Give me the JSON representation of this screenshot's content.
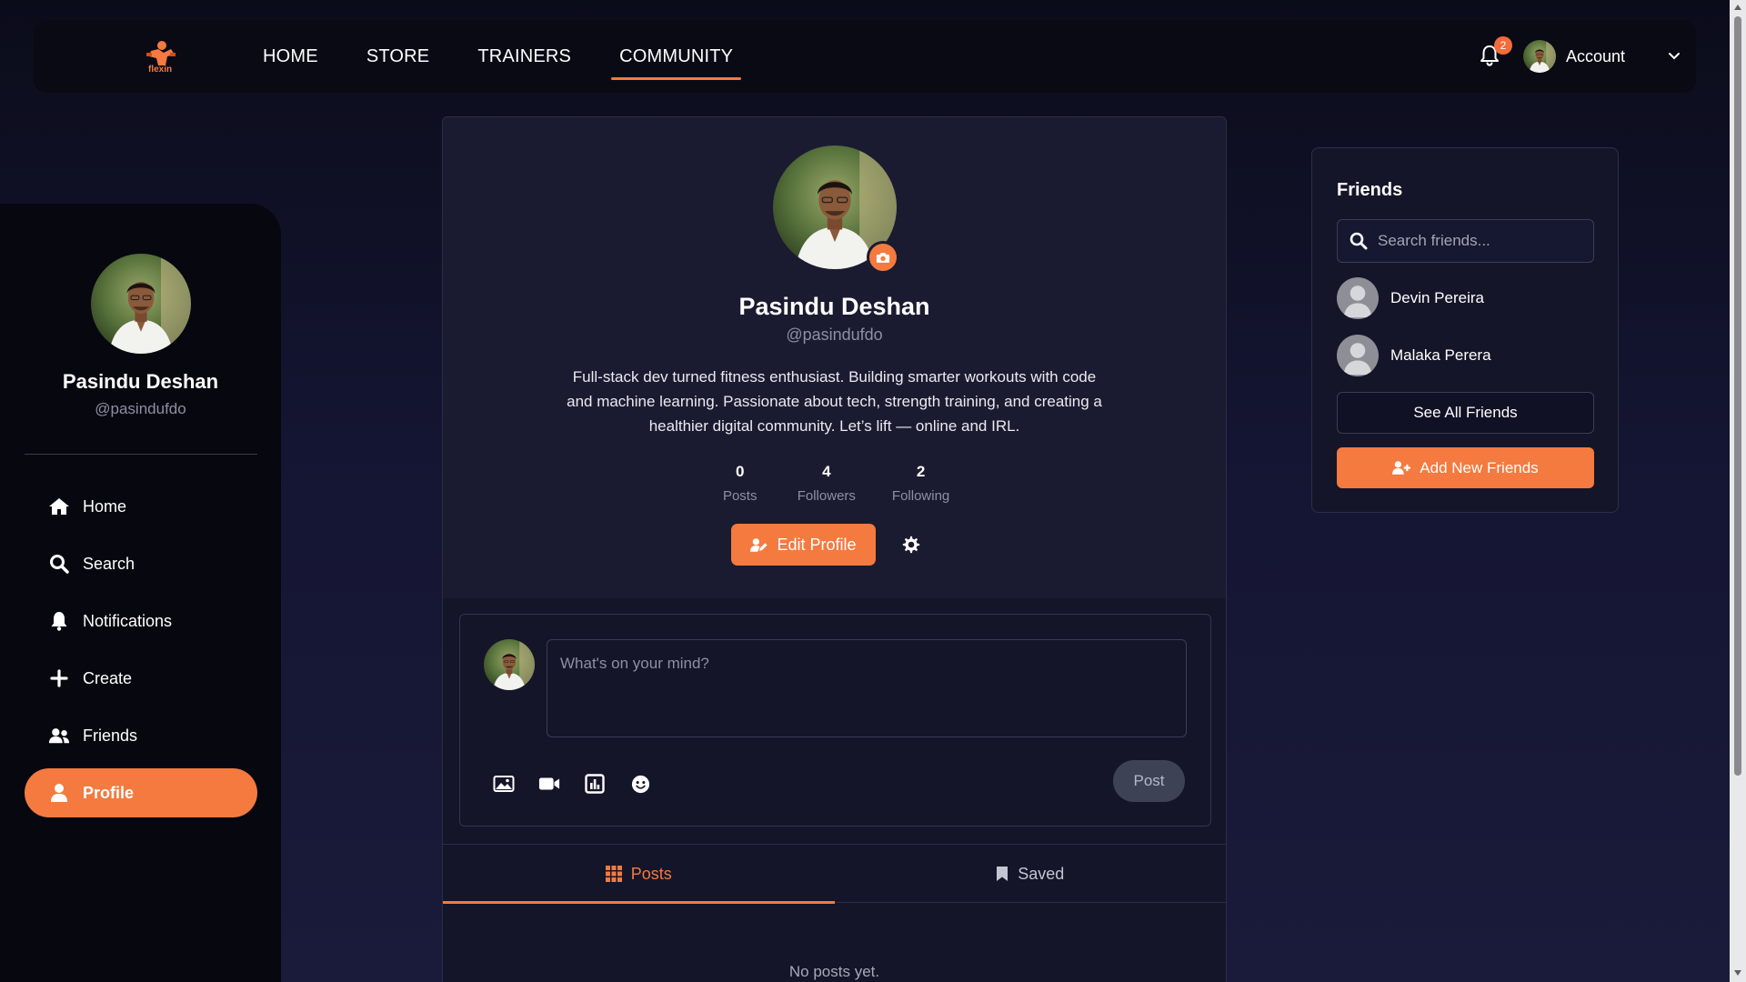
{
  "brand": {
    "logo_text": "flexin",
    "accent": "#f47a3f"
  },
  "nav": {
    "links": [
      {
        "label": "HOME"
      },
      {
        "label": "STORE"
      },
      {
        "label": "TRAINERS"
      },
      {
        "label": "COMMUNITY",
        "active": true
      }
    ],
    "notification_count": "2",
    "account_label": "Account"
  },
  "sidebar": {
    "name": "Pasindu Deshan",
    "handle": "@pasindufdo",
    "items": [
      {
        "label": "Home",
        "icon": "home-icon"
      },
      {
        "label": "Search",
        "icon": "search-icon"
      },
      {
        "label": "Notifications",
        "icon": "bell-icon"
      },
      {
        "label": "Create",
        "icon": "plus-icon"
      },
      {
        "label": "Friends",
        "icon": "users-icon"
      },
      {
        "label": "Profile",
        "icon": "user-icon",
        "active": true
      }
    ]
  },
  "profile": {
    "name": "Pasindu Deshan",
    "handle": "@pasindufdo",
    "bio": "Full-stack dev turned fitness enthusiast. Building smarter workouts with code and machine learning. Passionate about tech, strength training, and creating a healthier digital community. Let’s lift — online and IRL.",
    "stats": [
      {
        "value": "0",
        "label": "Posts"
      },
      {
        "value": "4",
        "label": "Followers"
      },
      {
        "value": "2",
        "label": "Following"
      }
    ],
    "edit_label": "Edit Profile"
  },
  "composer": {
    "placeholder": "What's on your mind?",
    "post_label": "Post",
    "tools": [
      "image-icon",
      "video-icon",
      "poll-icon",
      "emoji-icon"
    ]
  },
  "tabs": [
    {
      "label": "Posts",
      "icon": "grid-icon",
      "active": true
    },
    {
      "label": "Saved",
      "icon": "bookmark-icon"
    }
  ],
  "empty_text": "No posts yet.",
  "friends": {
    "title": "Friends",
    "search_placeholder": "Search friends...",
    "list": [
      {
        "name": "Devin Pereira"
      },
      {
        "name": "Malaka Perera"
      }
    ],
    "see_all_label": "See All Friends",
    "add_label": "Add New Friends"
  }
}
